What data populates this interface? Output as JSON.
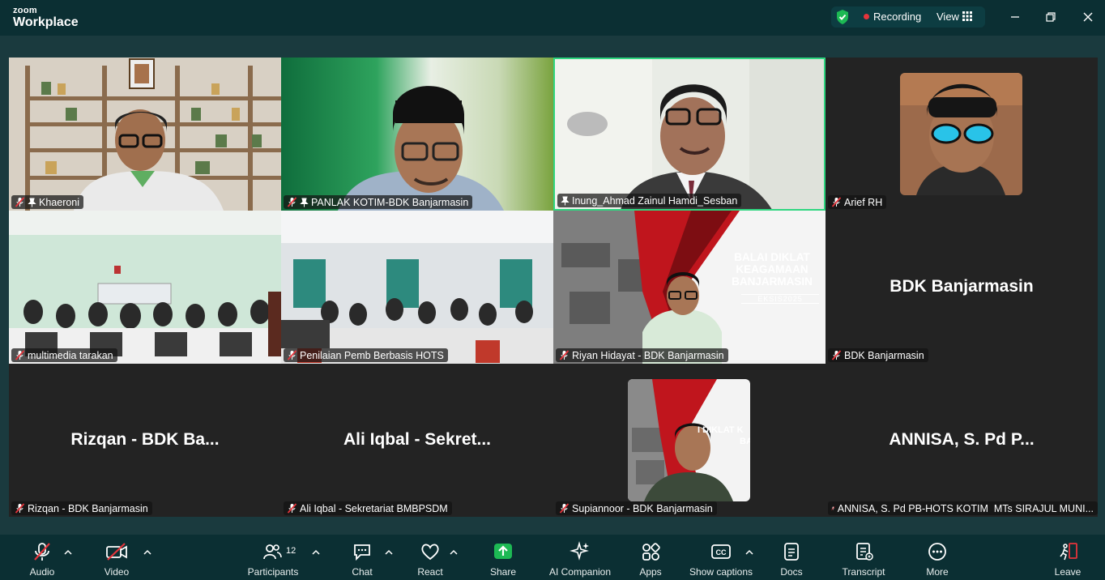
{
  "app": {
    "brand_small": "zoom",
    "brand_large": "Workplace"
  },
  "titlebar": {
    "recording_label": "Recording",
    "view_label": "View"
  },
  "colors": {
    "accent_green": "#2fd680",
    "recording_red": "#e5343b",
    "share_green": "#1db954",
    "muted_red": "#e5343b",
    "leave_red": "#e5343b"
  },
  "tiles": [
    {
      "name": "Khaeroni",
      "pinned": true,
      "muted": true
    },
    {
      "name": "PANLAK KOTIM-BDK Banjarmasin",
      "pinned": true,
      "muted": true
    },
    {
      "name": "Inung_Ahmad Zainul Hamdi_Sesban",
      "pinned": true,
      "muted": false,
      "active_speaker": true
    },
    {
      "name": "Arief RH",
      "muted": true
    },
    {
      "name": "multimedia tarakan",
      "muted": true
    },
    {
      "name": "Penilaian Pemb Berbasis HOTS",
      "muted": true
    },
    {
      "name": "Riyan Hidayat - BDK Banjarmasin",
      "muted": true
    },
    {
      "name": "BDK Banjarmasin",
      "display": "BDK Banjarmasin",
      "muted": true
    },
    {
      "name": "Rizqan - BDK Banjarmasin",
      "display": "Rizqan - BDK Ba...",
      "muted": true
    },
    {
      "name": "Ali Iqbal - Sekretariat BMBPSDM",
      "display": "Ali Iqbal - Sekret...",
      "muted": true
    },
    {
      "name": "Supiannoor - BDK Banjarmasin",
      "muted": true
    },
    {
      "name": "ANNISA, S. Pd PB-HOTS KOTIM  MTs SIRAJUL MUNI...",
      "display": "ANNISA, S. Pd P...",
      "muted": true
    }
  ],
  "slide": {
    "title_lines": [
      "BALAI DIKLAT",
      "KEAGAMAAN",
      "BANJARMASIN"
    ],
    "subtitle": "EKSIS2025",
    "small_title_lines": [
      "I DIKLAT K",
      "BA"
    ]
  },
  "toolbar": {
    "audio": "Audio",
    "video": "Video",
    "participants": "Participants",
    "participants_count": "12",
    "chat": "Chat",
    "react": "React",
    "share": "Share",
    "ai_companion": "AI Companion",
    "apps": "Apps",
    "captions": "Show captions",
    "docs": "Docs",
    "transcript": "Transcript",
    "more": "More",
    "leave": "Leave"
  }
}
